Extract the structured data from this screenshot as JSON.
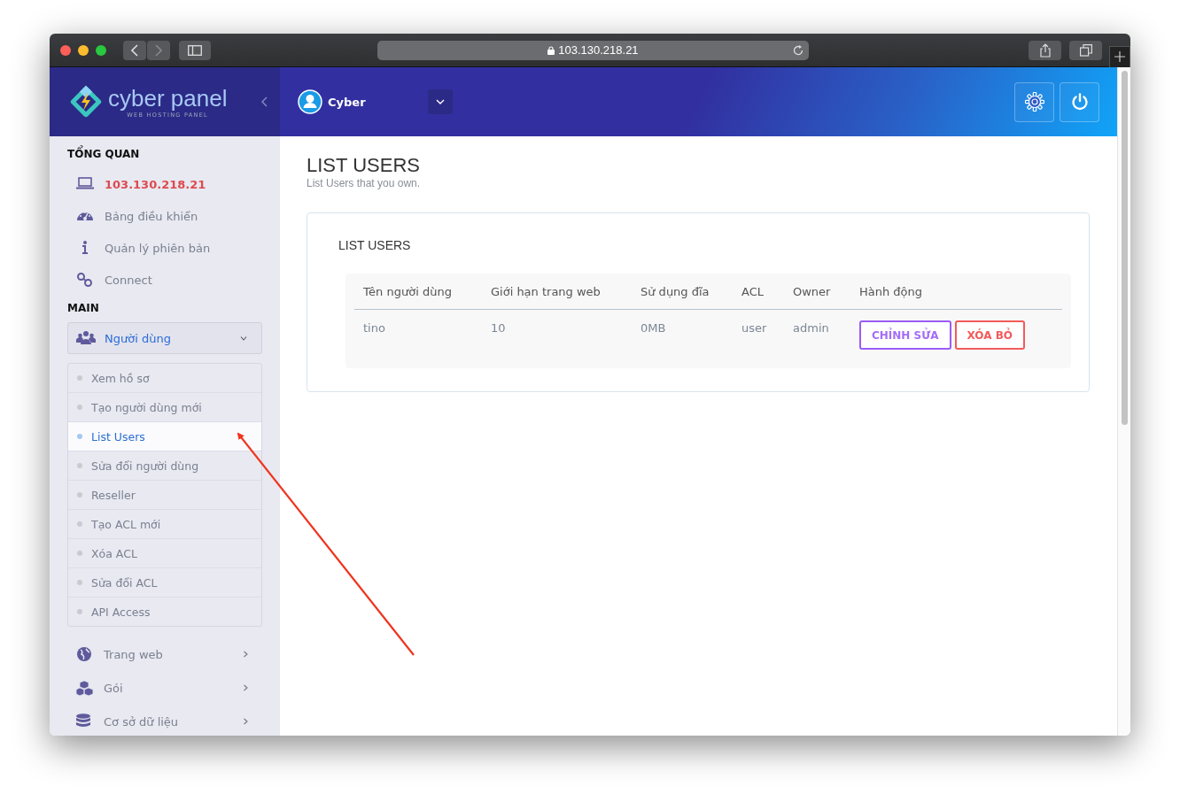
{
  "browser": {
    "url": "103.130.218.21"
  },
  "logo": {
    "name": "cyber panel",
    "tagline": "WEB HOSTING PANEL"
  },
  "header": {
    "user": "Cyber"
  },
  "sidebar": {
    "sections": [
      {
        "title": "TỔNG QUAN",
        "items": [
          {
            "label": "103.130.218.21",
            "kind": "host"
          },
          {
            "label": "Bảng điều khiển",
            "kind": "link"
          },
          {
            "label": "Quản lý phiên bản",
            "kind": "link"
          },
          {
            "label": "Connect",
            "kind": "link"
          }
        ]
      },
      {
        "title": "MAIN",
        "items": [
          {
            "label": "Người dùng",
            "kind": "menu",
            "expanded": true,
            "children": [
              {
                "label": "Xem hồ sơ",
                "selected": false
              },
              {
                "label": "Tạo người dùng mới",
                "selected": false
              },
              {
                "label": "List Users",
                "selected": true
              },
              {
                "label": "Sửa đổi người dùng",
                "selected": false
              },
              {
                "label": "Reseller",
                "selected": false
              },
              {
                "label": "Tạo ACL mới",
                "selected": false
              },
              {
                "label": "Xóa ACL",
                "selected": false
              },
              {
                "label": "Sửa đổi ACL",
                "selected": false
              },
              {
                "label": "API Access",
                "selected": false
              }
            ]
          },
          {
            "label": "Trang web",
            "kind": "menu",
            "expanded": false
          },
          {
            "label": "Gói",
            "kind": "menu",
            "expanded": false
          },
          {
            "label": "Cơ sở dữ liệu",
            "kind": "menu",
            "expanded": false
          }
        ]
      }
    ]
  },
  "page": {
    "title": "LIST USERS",
    "subtitle": "List Users that you own."
  },
  "card": {
    "title": "LIST USERS",
    "table": {
      "columns": [
        "Tên người dùng",
        "Giới hạn trang web",
        "Sử dụng đĩa",
        "ACL",
        "Owner",
        "Hành động"
      ],
      "rows": [
        {
          "cells": [
            "tino",
            "10",
            "0MB",
            "user",
            "admin"
          ],
          "actions": [
            {
              "label": "CHỈNH SỬA",
              "kind": "edit"
            },
            {
              "label": "XÓA BỎ",
              "kind": "delete"
            }
          ]
        }
      ]
    }
  }
}
